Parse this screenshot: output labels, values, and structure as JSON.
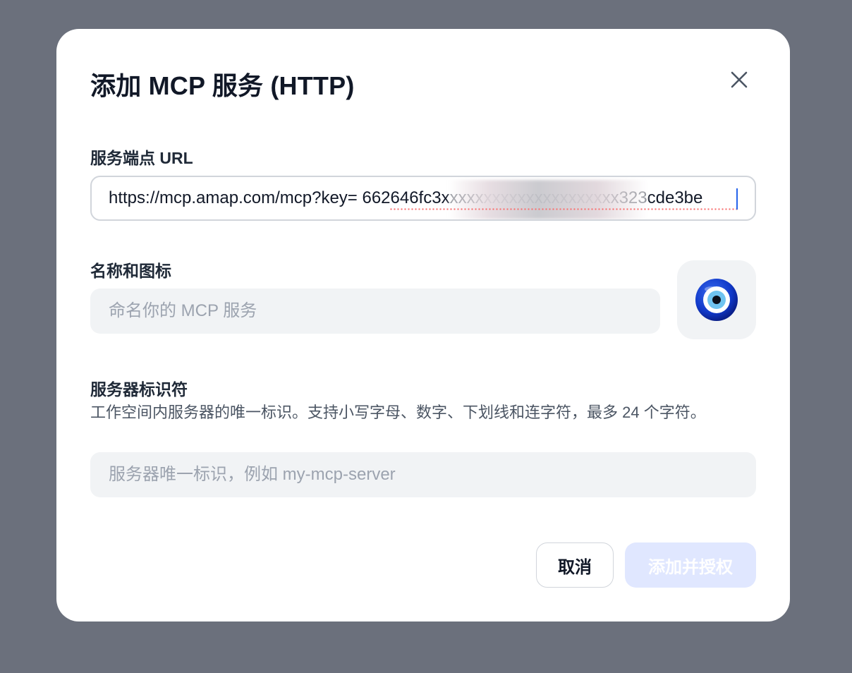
{
  "dialog": {
    "title": "添加 MCP 服务 (HTTP)",
    "close_icon": "close-icon"
  },
  "endpoint": {
    "label": "服务端点 URL",
    "value": "https://mcp.amap.com/mcp?key= 662646fc3xxxxxxxxxxxxxxxxxxxxx323cde3be"
  },
  "name_icon": {
    "label": "名称和图标",
    "placeholder": "命名你的 MCP 服务",
    "icon": "nazar-amulet-icon"
  },
  "server_id": {
    "label": "服务器标识符",
    "description": "工作空间内服务器的唯一标识。支持小写字母、数字、下划线和连字符，最多 24 个字符。",
    "placeholder": "服务器唯一标识，例如 my-mcp-server"
  },
  "actions": {
    "cancel": "取消",
    "submit": "添加并授权"
  },
  "colors": {
    "overlay": "#6b707c",
    "submit_disabled": "#e0e7ff",
    "caret": "#2563eb"
  }
}
